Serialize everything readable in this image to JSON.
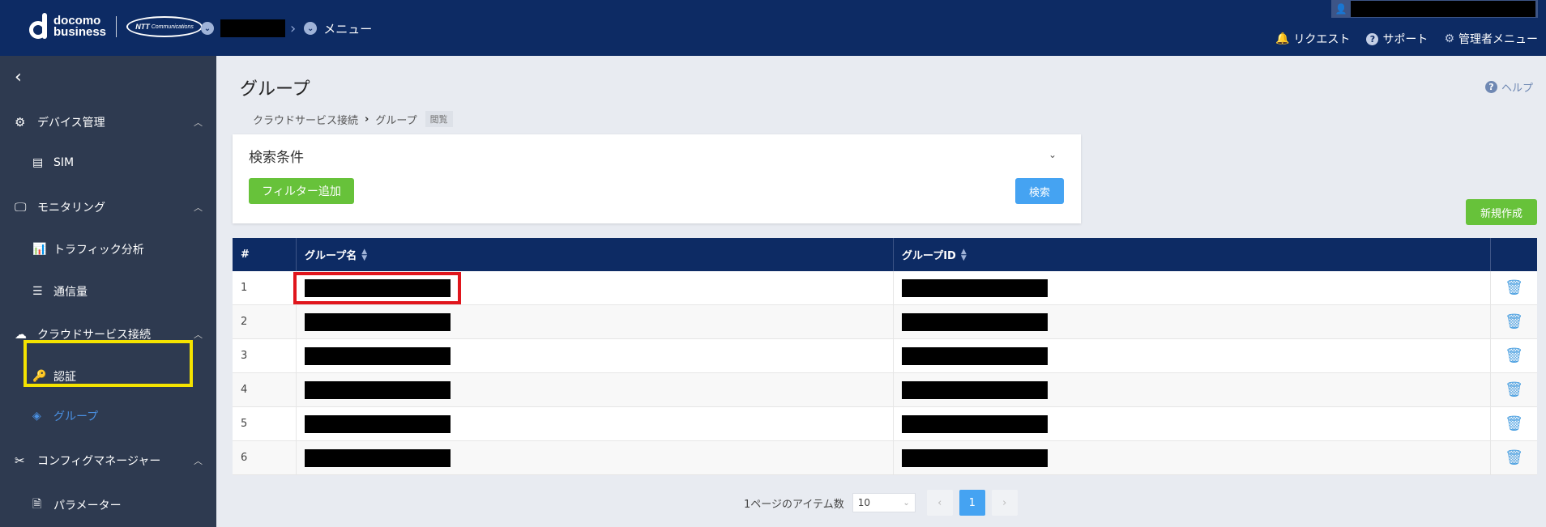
{
  "header": {
    "brand_line1": "docomo",
    "brand_line2": "business",
    "partner_logo": "NTT Communications",
    "menu_label": "メニュー",
    "links": {
      "request": "リクエスト",
      "support": "サポート",
      "admin_menu": "管理者メニュー"
    }
  },
  "sidebar": {
    "device_mgmt": "デバイス管理",
    "sim": "SIM",
    "monitoring": "モニタリング",
    "traffic_analysis": "トラフィック分析",
    "data_usage": "通信量",
    "cloud_connect": "クラウドサービス接続",
    "auth": "認証",
    "group": "グループ",
    "config_manager": "コンフィグマネージャー",
    "parameter": "パラメーター"
  },
  "page": {
    "title": "グループ",
    "help": "ヘルプ",
    "breadcrumb": [
      "クラウドサービス接続",
      "グループ"
    ],
    "mode_badge": "閲覧"
  },
  "search": {
    "title": "検索条件",
    "add_filter": "フィルター追加",
    "search": "検索"
  },
  "actions": {
    "create_new": "新規作成"
  },
  "table": {
    "headers": [
      "#",
      "グループ名",
      "グループID",
      ""
    ],
    "rows": [
      {
        "num": "1"
      },
      {
        "num": "2"
      },
      {
        "num": "3"
      },
      {
        "num": "4"
      },
      {
        "num": "5"
      },
      {
        "num": "6"
      }
    ]
  },
  "pagination": {
    "items_per_page_label": "1ページのアイテム数",
    "items_per_page": "10",
    "current_page": "1"
  },
  "colors": {
    "topbar": "#0d2b64",
    "sidebar": "#2e3a50",
    "accent_green": "#67c23a",
    "accent_blue": "#45a3f2",
    "highlight_yellow": "#f4e300",
    "highlight_red": "#e0151c"
  }
}
